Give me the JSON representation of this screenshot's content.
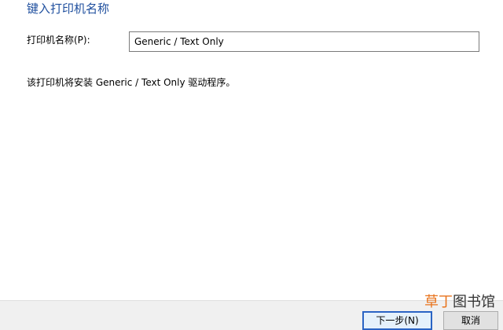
{
  "wizard": {
    "heading": "键入打印机名称",
    "name_label": "打印机名称(P):",
    "name_value": "Generic / Text Only",
    "driver_note": "该打印机将安装 Generic / Text Only 驱动程序。"
  },
  "footer": {
    "next_label": "下一步(N)",
    "cancel_label": "取消"
  },
  "watermark": {
    "part1": "草丁",
    "part2": "图书馆"
  },
  "colors": {
    "heading": "#1f4f9e",
    "footer_bg": "#f0f0f0",
    "primary_button_border": "#2a64c4",
    "watermark_accent": "#e8731c"
  }
}
